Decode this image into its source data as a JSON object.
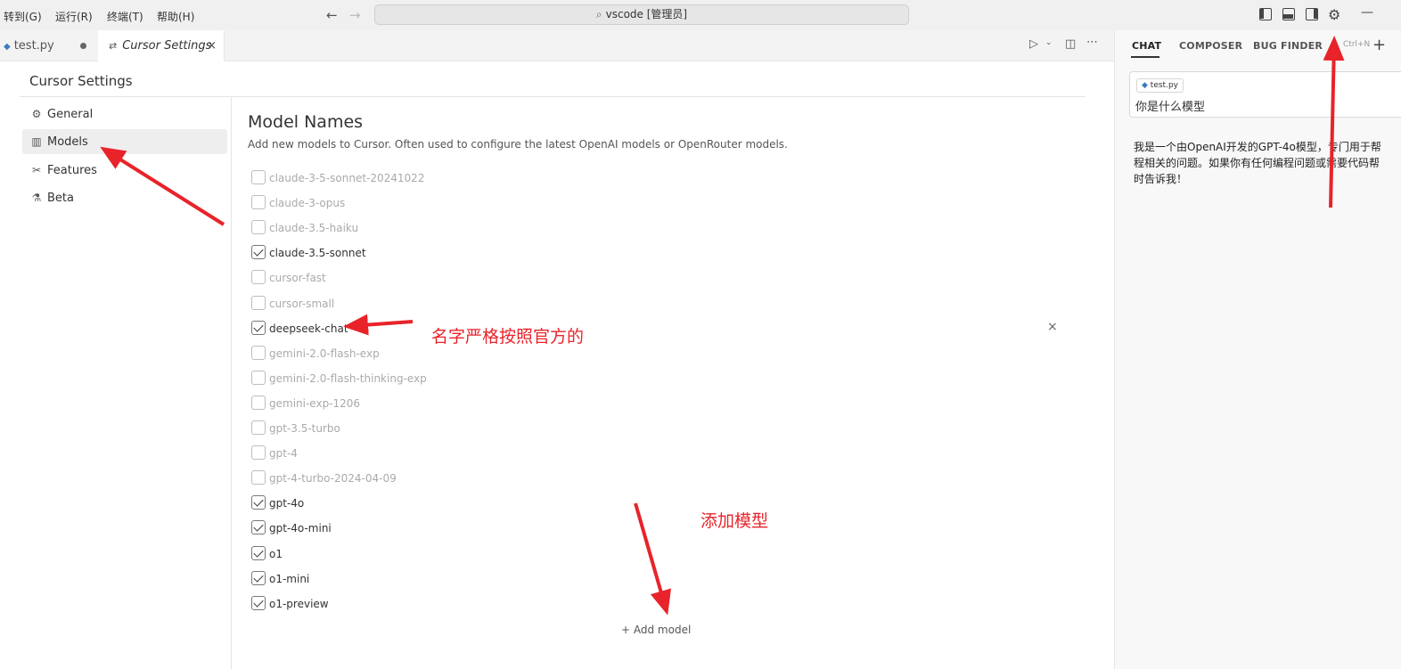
{
  "menu": [
    "转到(G)",
    "运行(R)",
    "终端(T)",
    "帮助(H)"
  ],
  "command_center": {
    "text": "vscode [管理员]"
  },
  "tabs": [
    {
      "label": "test.py",
      "dirty": true
    },
    {
      "label": "Cursor Settings",
      "close": "×"
    }
  ],
  "settings": {
    "title": "Cursor Settings",
    "sidebar": [
      {
        "label": "General",
        "icon": "gear-icon"
      },
      {
        "label": "Models",
        "icon": "bar-chart-icon",
        "active": true
      },
      {
        "label": "Features",
        "icon": "tools-icon"
      },
      {
        "label": "Beta",
        "icon": "flask-icon"
      }
    ],
    "section_title": "Model Names",
    "section_desc": "Add new models to Cursor. Often used to configure the latest OpenAI models or OpenRouter models.",
    "models": [
      {
        "name": "claude-3-5-sonnet-20241022",
        "checked": false
      },
      {
        "name": "claude-3-opus",
        "checked": false
      },
      {
        "name": "claude-3.5-haiku",
        "checked": false
      },
      {
        "name": "claude-3.5-sonnet",
        "checked": true
      },
      {
        "name": "cursor-fast",
        "checked": false
      },
      {
        "name": "cursor-small",
        "checked": false
      },
      {
        "name": "deepseek-chat",
        "checked": true,
        "removable": true
      },
      {
        "name": "gemini-2.0-flash-exp",
        "checked": false
      },
      {
        "name": "gemini-2.0-flash-thinking-exp",
        "checked": false
      },
      {
        "name": "gemini-exp-1206",
        "checked": false
      },
      {
        "name": "gpt-3.5-turbo",
        "checked": false
      },
      {
        "name": "gpt-4",
        "checked": false
      },
      {
        "name": "gpt-4-turbo-2024-04-09",
        "checked": false
      },
      {
        "name": "gpt-4o",
        "checked": true
      },
      {
        "name": "gpt-4o-mini",
        "checked": true
      },
      {
        "name": "o1",
        "checked": true
      },
      {
        "name": "o1-mini",
        "checked": true
      },
      {
        "name": "o1-preview",
        "checked": true
      }
    ],
    "remove_glyph": "×",
    "add_model": "+ Add model"
  },
  "chat": {
    "tabs": [
      "CHAT",
      "COMPOSER",
      "BUG FINDER"
    ],
    "shortcut": "Ctrl+N",
    "file_chip": "test.py",
    "question": "你是什么模型",
    "answer_lines": [
      "我是一个由OpenAI开发的GPT-4o模型，专门用于帮",
      "程相关的问题。如果你有任何编程问题或需要代码帮",
      "时告诉我！"
    ]
  },
  "annotations": {
    "official_name": "名字严格按照官方的",
    "add_model": "添加模型"
  },
  "colors": {
    "annotation": "#e8232a",
    "python": "#3b7bbf"
  }
}
